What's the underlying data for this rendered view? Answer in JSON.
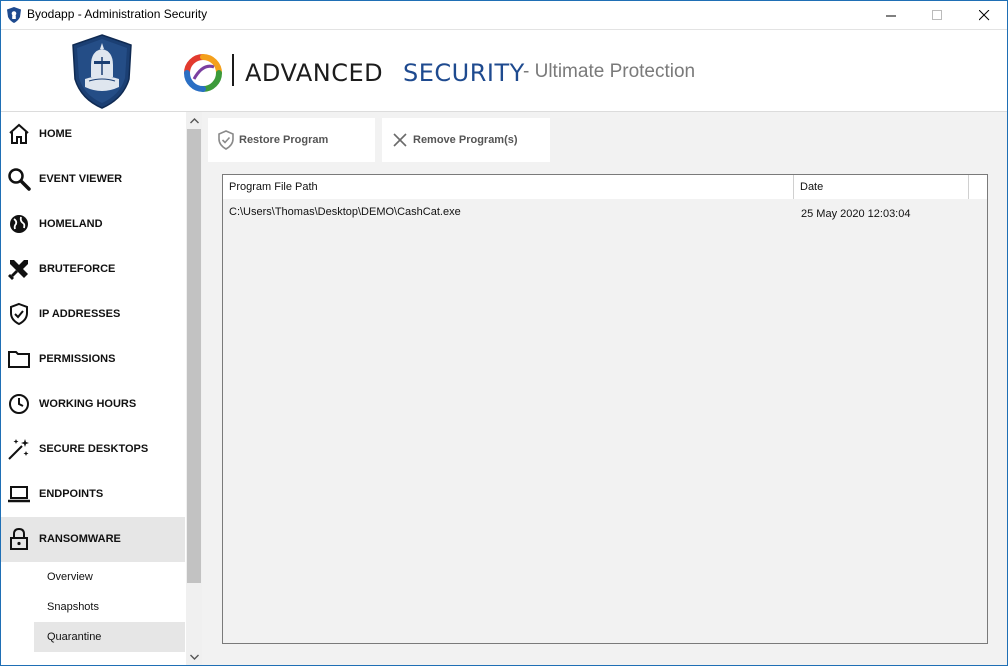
{
  "window": {
    "title": "Byodapp - Administration Security",
    "controls": [
      "minimize",
      "maximize",
      "close"
    ]
  },
  "header": {
    "brand_main": "ADVANCED",
    "brand_accent": "SECURITY",
    "tagline": "- Ultimate Protection",
    "accent_color": "#1e4a8f"
  },
  "sidebar": {
    "items": [
      {
        "label": "HOME",
        "icon": "home-icon"
      },
      {
        "label": "EVENT VIEWER",
        "icon": "search-icon"
      },
      {
        "label": "HOMELAND",
        "icon": "globe-icon"
      },
      {
        "label": "BRUTEFORCE",
        "icon": "crossed-swords-icon"
      },
      {
        "label": "IP ADDRESSES",
        "icon": "shield-check-icon"
      },
      {
        "label": "PERMISSIONS",
        "icon": "folder-icon"
      },
      {
        "label": "WORKING HOURS",
        "icon": "clock-icon"
      },
      {
        "label": "SECURE DESKTOPS",
        "icon": "magic-wand-icon"
      },
      {
        "label": "ENDPOINTS",
        "icon": "laptop-icon"
      },
      {
        "label": "RANSOMWARE",
        "icon": "lock-icon",
        "active": true
      }
    ],
    "sub_items": [
      {
        "label": "Overview"
      },
      {
        "label": "Snapshots"
      },
      {
        "label": "Quarantine",
        "active": true
      }
    ]
  },
  "toolbar": {
    "restore_label": "Restore Program",
    "remove_label": "Remove Program(s)"
  },
  "table": {
    "columns": [
      "Program File Path",
      "Date"
    ],
    "rows": [
      [
        "C:\\Users\\Thomas\\Desktop\\DEMO\\CashCat.exe",
        "25 May 2020 12:03:04"
      ]
    ]
  }
}
